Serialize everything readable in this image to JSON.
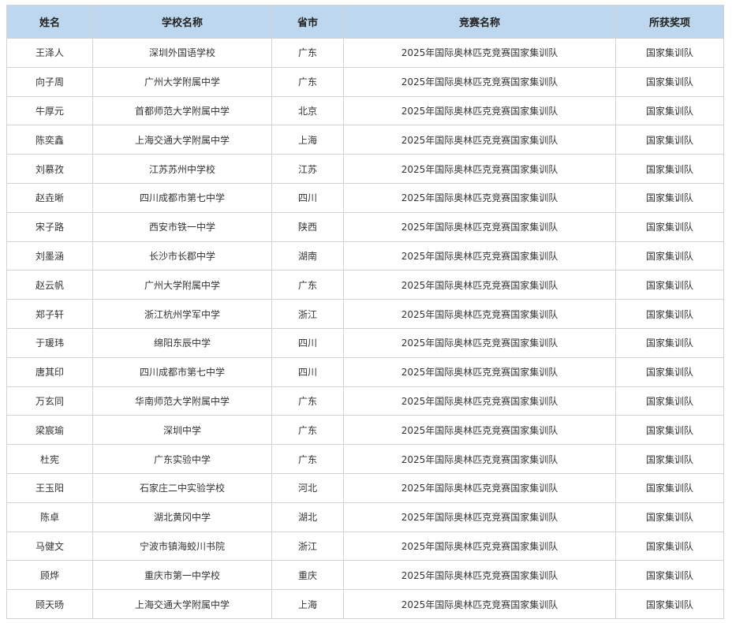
{
  "table": {
    "headers": [
      "姓名",
      "学校名称",
      "省市",
      "竞赛名称",
      "所获奖项"
    ],
    "rows": [
      [
        "王泽人",
        "深圳外国语学校",
        "广东",
        "2025年国际奥林匹克竞赛国家集训队",
        "国家集训队"
      ],
      [
        "向子周",
        "广州大学附属中学",
        "广东",
        "2025年国际奥林匹克竞赛国家集训队",
        "国家集训队"
      ],
      [
        "牛厚元",
        "首都师范大学附属中学",
        "北京",
        "2025年国际奥林匹克竞赛国家集训队",
        "国家集训队"
      ],
      [
        "陈奕鑫",
        "上海交通大学附属中学",
        "上海",
        "2025年国际奥林匹克竞赛国家集训队",
        "国家集训队"
      ],
      [
        "刘慕孜",
        "江苏苏州中学校",
        "江苏",
        "2025年国际奥林匹克竞赛国家集训队",
        "国家集训队"
      ],
      [
        "赵垚晰",
        "四川成都市第七中学",
        "四川",
        "2025年国际奥林匹克竞赛国家集训队",
        "国家集训队"
      ],
      [
        "宋子路",
        "西安市铁一中学",
        "陕西",
        "2025年国际奥林匹克竞赛国家集训队",
        "国家集训队"
      ],
      [
        "刘墨涵",
        "长沙市长郡中学",
        "湖南",
        "2025年国际奥林匹克竞赛国家集训队",
        "国家集训队"
      ],
      [
        "赵云帆",
        "广州大学附属中学",
        "广东",
        "2025年国际奥林匹克竞赛国家集训队",
        "国家集训队"
      ],
      [
        "郑子轩",
        "浙江杭州学军中学",
        "浙江",
        "2025年国际奥林匹克竞赛国家集训队",
        "国家集训队"
      ],
      [
        "于瑗玮",
        "绵阳东辰中学",
        "四川",
        "2025年国际奥林匹克竞赛国家集训队",
        "国家集训队"
      ],
      [
        "唐其印",
        "四川成都市第七中学",
        "四川",
        "2025年国际奥林匹克竞赛国家集训队",
        "国家集训队"
      ],
      [
        "万玄同",
        "华南师范大学附属中学",
        "广东",
        "2025年国际奥林匹克竞赛国家集训队",
        "国家集训队"
      ],
      [
        "梁宸瑜",
        "深圳中学",
        "广东",
        "2025年国际奥林匹克竞赛国家集训队",
        "国家集训队"
      ],
      [
        "杜宪",
        "广东实验中学",
        "广东",
        "2025年国际奥林匹克竞赛国家集训队",
        "国家集训队"
      ],
      [
        "王玉阳",
        "石家庄二中实验学校",
        "河北",
        "2025年国际奥林匹克竞赛国家集训队",
        "国家集训队"
      ],
      [
        "陈卓",
        "湖北黄冈中学",
        "湖北",
        "2025年国际奥林匹克竞赛国家集训队",
        "国家集训队"
      ],
      [
        "马健文",
        "宁波市镇海蛟川书院",
        "浙江",
        "2025年国际奥林匹克竞赛国家集训队",
        "国家集训队"
      ],
      [
        "顾烨",
        "重庆市第一中学校",
        "重庆",
        "2025年国际奥林匹克竞赛国家集训队",
        "国家集训队"
      ],
      [
        "顾天旸",
        "上海交通大学附属中学",
        "上海",
        "2025年国际奥林匹克竞赛国家集训队",
        "国家集训队"
      ]
    ]
  },
  "colors": {
    "header_bg": "#bdd7ee",
    "border": "#d2d2d2"
  }
}
